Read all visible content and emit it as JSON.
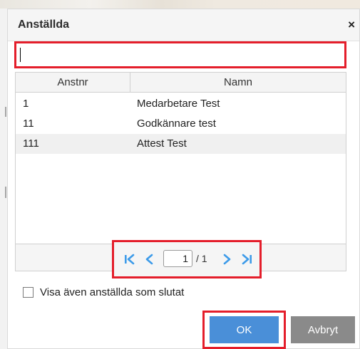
{
  "dialog": {
    "title": "Anställda",
    "close_glyph": "×"
  },
  "search": {
    "value": "",
    "placeholder": ""
  },
  "grid": {
    "columns": [
      "Anstnr",
      "Namn"
    ],
    "rows": [
      {
        "anstnr": "1",
        "namn": "Medarbetare Test"
      },
      {
        "anstnr": "11",
        "namn": "Godkännare test"
      },
      {
        "anstnr": "111",
        "namn": "Attest Test"
      }
    ]
  },
  "pager": {
    "current_page": "1",
    "total_text": "/ 1",
    "icons": [
      "first-page-icon",
      "prev-page-icon",
      "next-page-icon",
      "last-page-icon"
    ],
    "icon_color": "#3d9be9"
  },
  "options": {
    "show_terminated_label": "Visa även anställda som slutat",
    "show_terminated_checked": false
  },
  "buttons": {
    "ok_label": "OK",
    "cancel_label": "Avbryt"
  },
  "colors": {
    "highlight": "#e41e2b",
    "ok_button": "#4a8fd8",
    "cancel_button": "#8a8a8a"
  }
}
